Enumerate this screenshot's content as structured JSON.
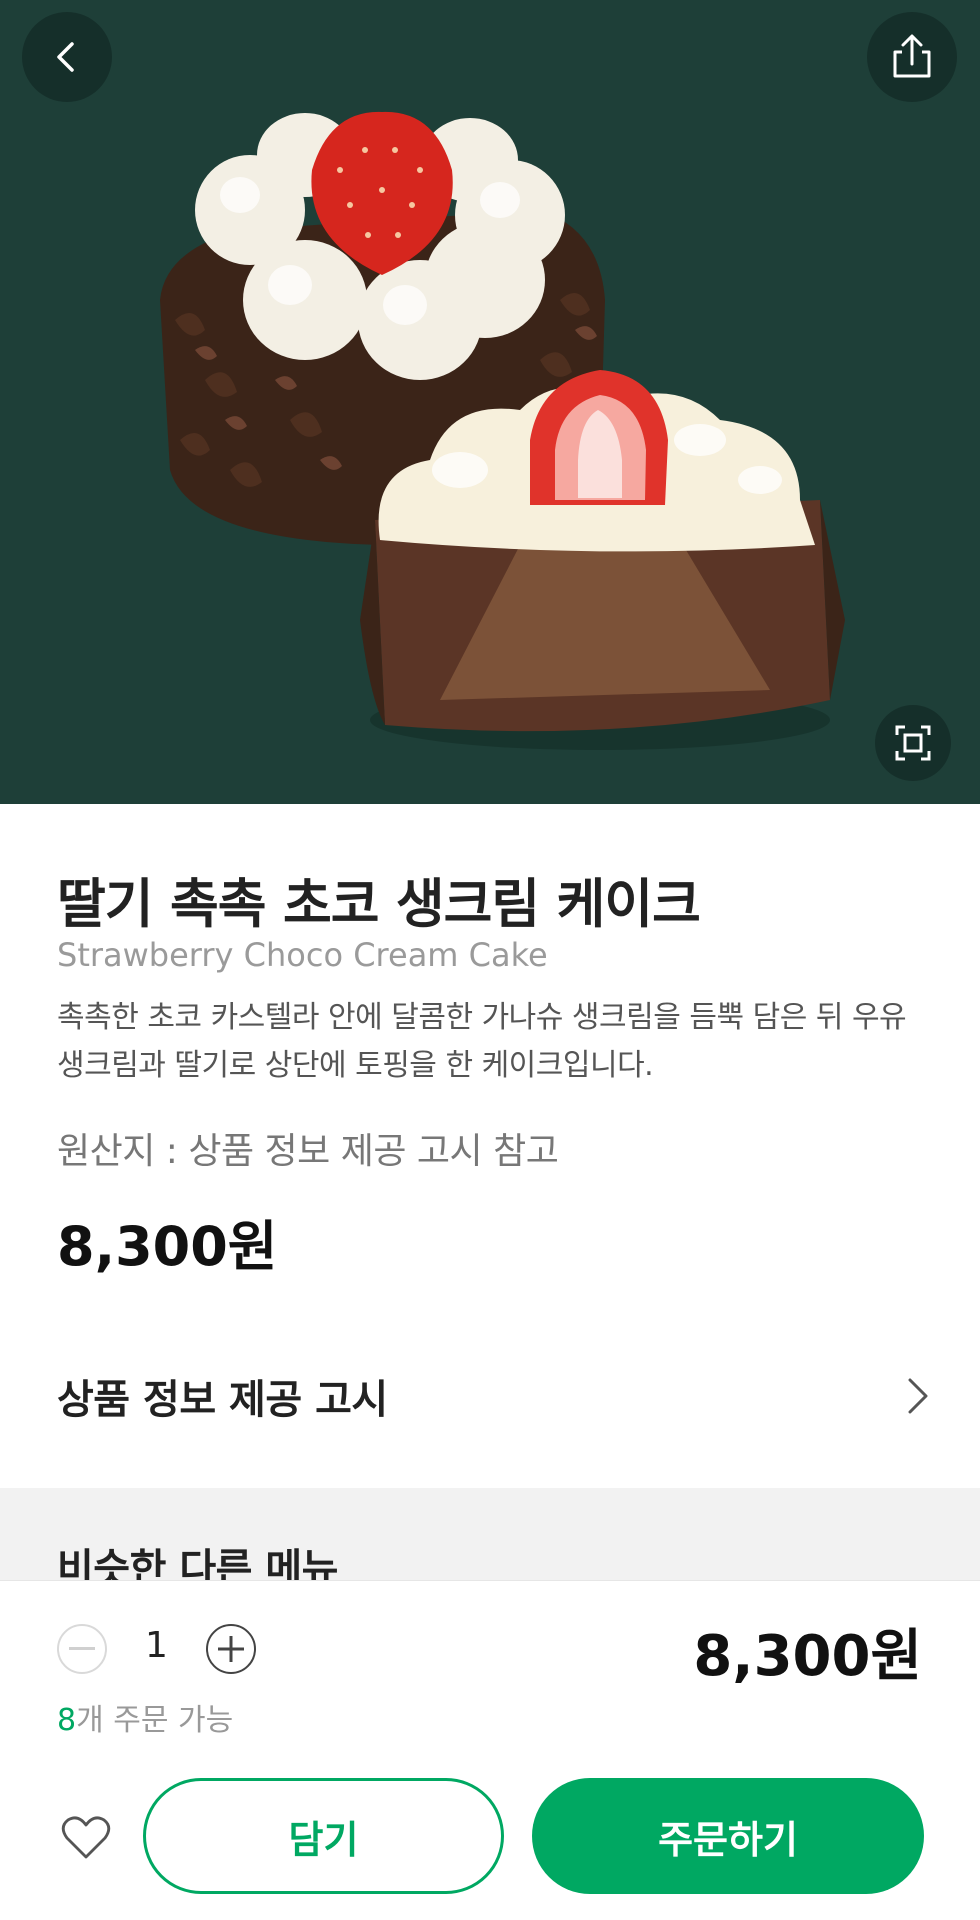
{
  "colors": {
    "hero_background": "#1e3f38",
    "brand_green": "#00a862",
    "section_gray": "#f2f2f2"
  },
  "header": {
    "back_icon": "chevron-left-icon",
    "share_icon": "share-icon",
    "zoom_icon": "fullscreen-icon"
  },
  "product": {
    "name_ko": "딸기 촉촉 초코 생크림 케이크",
    "name_en": "Strawberry Choco Cream Cake",
    "description": "촉촉한 초코 카스텔라 안에 달콤한 가나슈 생크림을 듬뿍 담은 뒤 우유 생크림과 딸기로 상단에 토핑을 한 케이크입니다.",
    "origin": "원산지 : 상품 정보 제공 고시 참고",
    "price": "8,300원"
  },
  "notice": {
    "label": "상품 정보 제공 고시"
  },
  "similar": {
    "title": "비슷한 다른 메뉴"
  },
  "order_bar": {
    "quantity": "1",
    "total_price": "8,300원",
    "available_count": "8",
    "available_suffix": "개 주문 가능",
    "cart_label": "담기",
    "order_label": "주문하기"
  }
}
